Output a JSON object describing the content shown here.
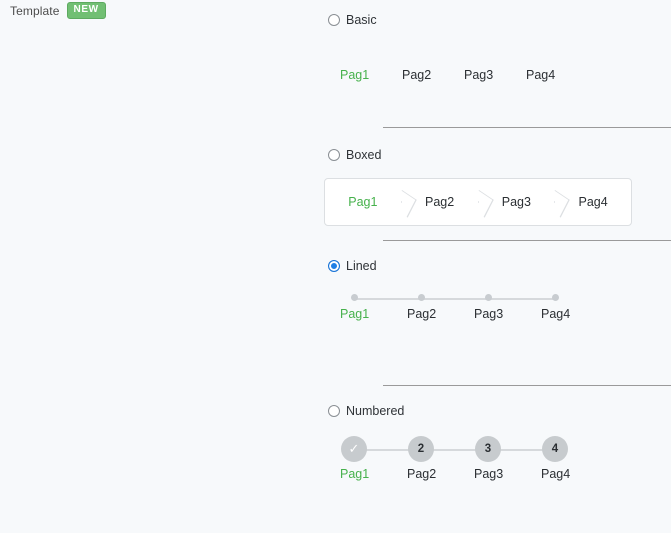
{
  "header": {
    "title": "Template",
    "badge": "NEW"
  },
  "colors": {
    "active_green": "#46b14c",
    "radio_selected_blue": "#1f7fe5",
    "badge_green": "#71bf73",
    "step_gray": "#c7cbce",
    "background": "#f7f9fb"
  },
  "options": [
    {
      "id": "basic",
      "label": "Basic",
      "selected": false,
      "style": "basic",
      "tabs": [
        {
          "label": "Pag1",
          "active": true
        },
        {
          "label": "Pag2",
          "active": false
        },
        {
          "label": "Pag3",
          "active": false
        },
        {
          "label": "Pag4",
          "active": false
        }
      ]
    },
    {
      "id": "boxed",
      "label": "Boxed",
      "selected": false,
      "style": "boxed",
      "tabs": [
        {
          "label": "Pag1",
          "active": true
        },
        {
          "label": "Pag2",
          "active": false
        },
        {
          "label": "Pag3",
          "active": false
        },
        {
          "label": "Pag4",
          "active": false
        }
      ]
    },
    {
      "id": "lined",
      "label": "Lined",
      "selected": true,
      "style": "lined",
      "tabs": [
        {
          "label": "Pag1",
          "active": true
        },
        {
          "label": "Pag2",
          "active": false
        },
        {
          "label": "Pag3",
          "active": false
        },
        {
          "label": "Pag4",
          "active": false
        }
      ]
    },
    {
      "id": "numbered",
      "label": "Numbered",
      "selected": false,
      "style": "numbered",
      "tabs": [
        {
          "label": "Pag1",
          "active": true,
          "marker": "✓",
          "completed": true
        },
        {
          "label": "Pag2",
          "active": false,
          "marker": "2",
          "completed": false
        },
        {
          "label": "Pag3",
          "active": false,
          "marker": "3",
          "completed": false
        },
        {
          "label": "Pag4",
          "active": false,
          "marker": "4",
          "completed": false
        }
      ]
    }
  ]
}
